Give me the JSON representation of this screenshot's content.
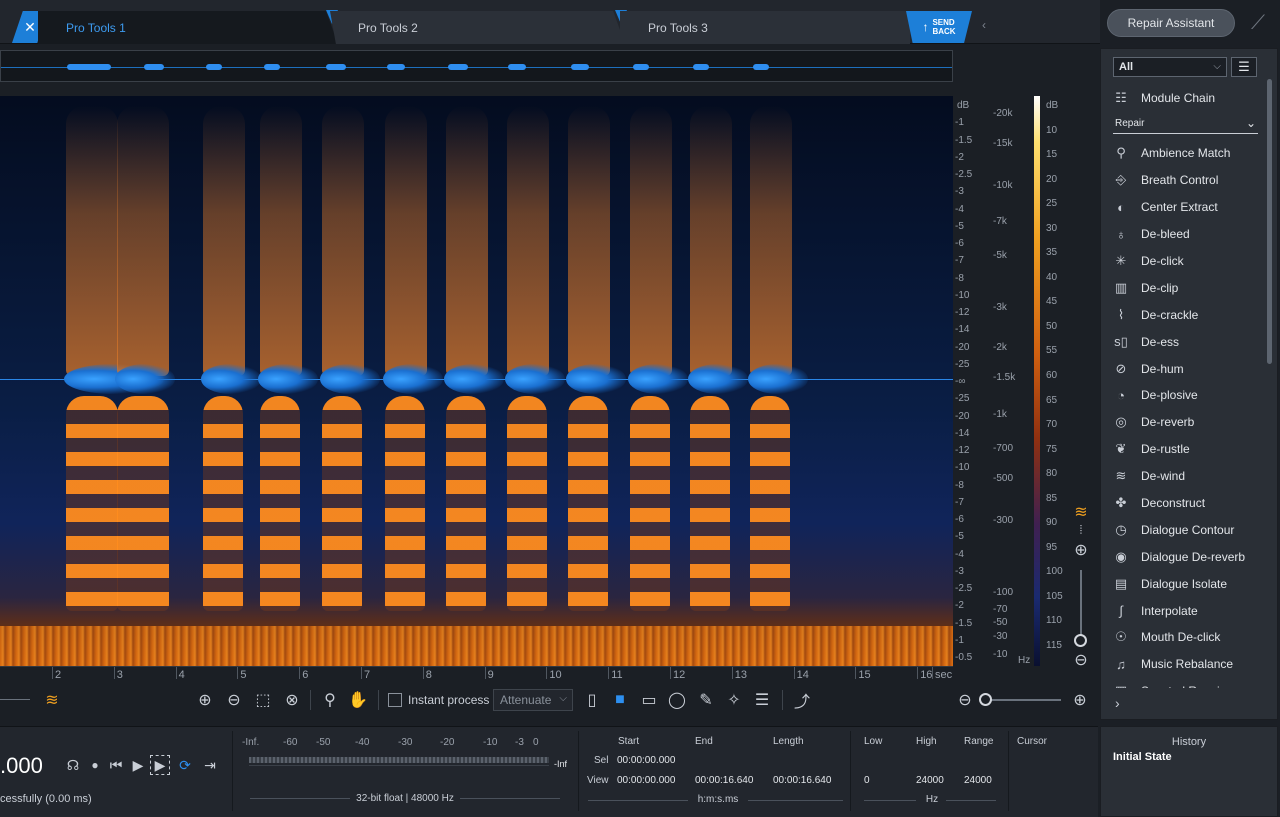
{
  "tabs": [
    {
      "label": "Pro Tools 1",
      "active": true
    },
    {
      "label": "Pro Tools 2",
      "active": false
    },
    {
      "label": "Pro Tools 3",
      "active": false
    }
  ],
  "send_back": {
    "line1": "SEND",
    "line2": "BACK"
  },
  "repair_assistant_label": "Repair Assistant",
  "db_scale": [
    "dB",
    "-1",
    "-1.5",
    "-2",
    "-2.5",
    "-3",
    "-4",
    "-5",
    "-6",
    "-7",
    "-8",
    "-10",
    "-12",
    "-14",
    "-20",
    "-25",
    "-∞",
    "-25",
    "-20",
    "-14",
    "-12",
    "-10",
    "-8",
    "-7",
    "-6",
    "-5",
    "-4",
    "-3",
    "-2.5",
    "-2",
    "-1.5",
    "-1",
    "-0.5"
  ],
  "freq_scale": [
    "-20k",
    "-15k",
    "-10k",
    "-7k",
    "-5k",
    "-3k",
    "-2k",
    "-1.5k",
    "-1k",
    "-700",
    "-500",
    "-300",
    "-100",
    "-70",
    "-50",
    "-30",
    "-10",
    "Hz"
  ],
  "colorbar_scale": [
    "dB",
    "10",
    "15",
    "20",
    "25",
    "30",
    "35",
    "40",
    "45",
    "50",
    "55",
    "60",
    "65",
    "70",
    "75",
    "80",
    "85",
    "90",
    "95",
    "100",
    "105",
    "110",
    "115"
  ],
  "time_ruler": [
    "2",
    "3",
    "4",
    "5",
    "6",
    "7",
    "8",
    "9",
    "10",
    "11",
    "12",
    "13",
    "14",
    "15",
    "16",
    "sec"
  ],
  "toolbar": {
    "instant_process_label": "Instant process",
    "attenuate_label": "Attenuate"
  },
  "transport": {
    "time_display": ".000",
    "status": "cessfully (0.00 ms)"
  },
  "meter": {
    "scale": [
      "-Inf.",
      "-60",
      "-50",
      "-40",
      "-30",
      "-20",
      "-10",
      "-3",
      "0"
    ],
    "inf_label": "-Inf",
    "format": "32-bit float | 48000 Hz"
  },
  "selection": {
    "headers": {
      "start": "Start",
      "end": "End",
      "length": "Length"
    },
    "sel_label": "Sel",
    "view_label": "View",
    "sel": {
      "start": "00:00:00.000",
      "end": "",
      "length": ""
    },
    "view": {
      "start": "00:00:00.000",
      "end": "00:00:16.640",
      "length": "00:00:16.640"
    },
    "unit": "h:m:s.ms"
  },
  "frequency": {
    "headers": {
      "low": "Low",
      "high": "High",
      "range": "Range"
    },
    "low": "0",
    "high": "24000",
    "range": "24000",
    "unit": "Hz"
  },
  "cursor_label": "Cursor",
  "right_panel": {
    "filter": "All",
    "module_chain_label": "Module Chain",
    "category": "Repair",
    "modules": [
      {
        "label": "Ambience Match",
        "icon": "ambience-match-icon",
        "glyph": "⚲"
      },
      {
        "label": "Breath Control",
        "icon": "breath-control-icon",
        "glyph": "⎆"
      },
      {
        "label": "Center Extract",
        "icon": "center-extract-icon",
        "glyph": "◐"
      },
      {
        "label": "De-bleed",
        "icon": "de-bleed-icon",
        "glyph": "♁"
      },
      {
        "label": "De-click",
        "icon": "de-click-icon",
        "glyph": "✳"
      },
      {
        "label": "De-clip",
        "icon": "de-clip-icon",
        "glyph": "▥"
      },
      {
        "label": "De-crackle",
        "icon": "de-crackle-icon",
        "glyph": "⌇"
      },
      {
        "label": "De-ess",
        "icon": "de-ess-icon",
        "glyph": "s▯"
      },
      {
        "label": "De-hum",
        "icon": "de-hum-icon",
        "glyph": "⊘"
      },
      {
        "label": "De-plosive",
        "icon": "de-plosive-icon",
        "glyph": "◔"
      },
      {
        "label": "De-reverb",
        "icon": "de-reverb-icon",
        "glyph": "◎"
      },
      {
        "label": "De-rustle",
        "icon": "de-rustle-icon",
        "glyph": "❦"
      },
      {
        "label": "De-wind",
        "icon": "de-wind-icon",
        "glyph": "≋"
      },
      {
        "label": "Deconstruct",
        "icon": "deconstruct-icon",
        "glyph": "✤"
      },
      {
        "label": "Dialogue Contour",
        "icon": "dialogue-contour-icon",
        "glyph": "◷"
      },
      {
        "label": "Dialogue De-reverb",
        "icon": "dialogue-de-reverb-icon",
        "glyph": "◉"
      },
      {
        "label": "Dialogue Isolate",
        "icon": "dialogue-isolate-icon",
        "glyph": "▤"
      },
      {
        "label": "Interpolate",
        "icon": "interpolate-icon",
        "glyph": "∫"
      },
      {
        "label": "Mouth De-click",
        "icon": "mouth-de-click-icon",
        "glyph": "☉"
      },
      {
        "label": "Music Rebalance",
        "icon": "music-rebalance-icon",
        "glyph": "♫"
      },
      {
        "label": "Spectral Repair",
        "icon": "spectral-repair-icon",
        "glyph": "▦"
      }
    ]
  },
  "history": {
    "title": "History",
    "items": [
      "Initial State"
    ]
  },
  "colors": {
    "accent": "#1d7fd8",
    "background": "#1b1f25",
    "panel": "#2a2f36",
    "spectrogram_hot": "#f08a20",
    "waveform": "#2a86e6"
  }
}
